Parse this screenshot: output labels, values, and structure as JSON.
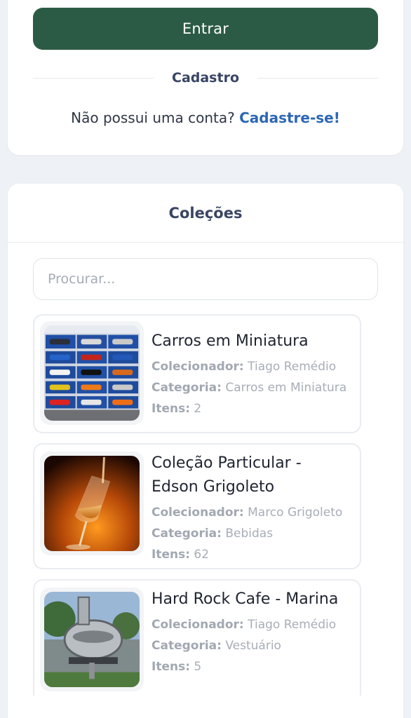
{
  "login": {
    "button_label": "Entrar",
    "divider_label": "Cadastro",
    "signup_prompt": "Não possui uma conta?",
    "signup_link": "Cadastre-se!"
  },
  "colors": {
    "primary": "#2c5b45",
    "link": "#2d67b5",
    "heading": "#394563",
    "background": "#eef1f5"
  },
  "collections": {
    "title": "Coleções",
    "search_placeholder": "Procurar...",
    "collector_label": "Colecionador:",
    "category_label": "Categoria:",
    "items_label": "Itens:",
    "list": [
      {
        "name": "Carros em Miniatura",
        "collector": "Tiago Remédio",
        "category": "Carros em Miniatura",
        "items": "2",
        "thumb_icon": "miniature-cars-photo"
      },
      {
        "name": "Coleção Particular - Edson Grigoleto",
        "collector": "Marco Grigoleto",
        "category": "Bebidas",
        "items": "62",
        "thumb_icon": "liquor-glass-photo"
      },
      {
        "name": "Hard Rock Cafe - Marina",
        "collector": "Tiago Remédio",
        "category": "Vestuário",
        "items": "5",
        "thumb_icon": "hard-rock-cafe-sign-photo"
      }
    ]
  }
}
